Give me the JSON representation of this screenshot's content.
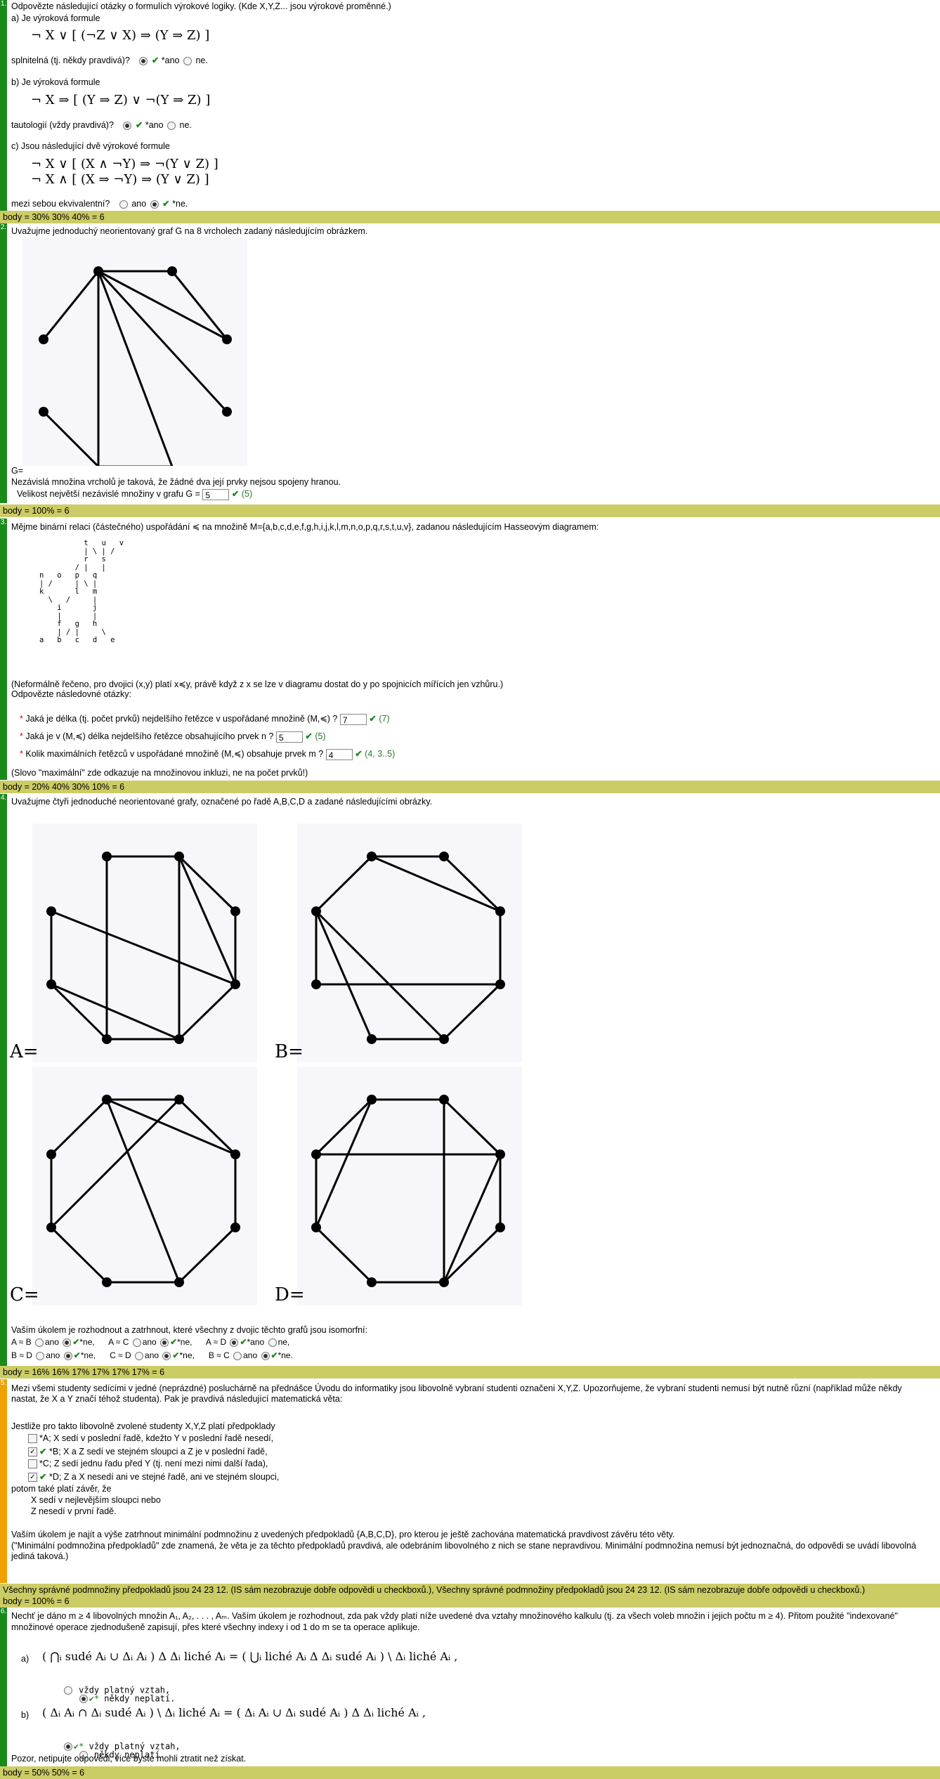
{
  "q1": {
    "num": "1.",
    "intro": "Odpovězte následující otázky o formulích výrokové logiky. (Kde X,Y,Z... jsou výrokové proměnné.)",
    "a_label": "a) Je výroková formule",
    "a_formula": "¬ X ∨ [ (¬Z ∨ X) ⇒ (Y ⇒ Z) ]",
    "a_question": "splnitelná (tj. někdy pravdivá)?",
    "b_label": "b) Je výroková formule",
    "b_formula": "¬ X ⇒ [ (Y ⇒ Z) ∨ ¬(Y ⇒ Z) ]",
    "b_question": "tautologií (vždy pravdivá)?",
    "c_label": "c) Jsou následující dvě výrokové formule",
    "c_formula1": "¬ X ∨ [ (X ∧ ¬Y) ⇒ ¬(Y ∨ Z) ]",
    "c_formula2": "¬ X ∧ [ (X ⇒ ¬Y) ⇒ (Y ∨ Z) ]",
    "c_question": "mezi sebou ekvivalentní?",
    "yes_star": "*ano",
    "no": "ne.",
    "yes": "ano",
    "no_star": "*ne.",
    "check": "✔",
    "points": "body = 30% 30% 40% = 6"
  },
  "q2": {
    "num": "2.",
    "intro": "Uvažujme jednoduchý neorientovaný graf G na 8 vrcholech zadaný následujícím obrázkem.",
    "glabel": "G=",
    "def": "Nezávislá množina vrcholů je taková, že žádné dva její prvky nejsou spojeny hranou.",
    "question": "Velikost největší nezávislé množiny v grafu G =",
    "value": "5",
    "answer": "(5)",
    "points": "body = 100% = 6"
  },
  "q3": {
    "num": "3.",
    "intro": "Mějme binární relaci (částečného) uspořádání ≼ na množině M={a,b,c,d,e,f,g,h,i,j,k,l,m,n,o,p,q,r,s,t,u,v}, zadanou následujícím Hasseovým diagramem:",
    "hasse_lines": [
      "          t   u   v",
      "          | \\ | /",
      "          r   s",
      "        / |   |",
      "n   o   p   q",
      "| /     | \\ |",
      "k       l   m",
      "  \\   /     |",
      "    i       j",
      "    |       |",
      "    f   g   h",
      "    | / |     \\",
      "a   b   c   d   e"
    ],
    "informal": "(Neformálně řečeno, pro dvojici (x,y) platí x≼y, právě když z x se lze v diagramu dostat do y po spojnicích mířících jen vzhůru.)",
    "answer_prompt": "Odpovězte následovné otázky:",
    "items": [
      {
        "text": "Jaká je délka (tj. počet prvků) nejdelšího řetězce v uspořádané množině (M,≼) ?",
        "value": "7",
        "answer": "(7)"
      },
      {
        "text": "Jaká je v (M,≼) délka nejdelšího řetězce obsahujícího prvek n ?",
        "value": "5",
        "answer": "(5)"
      },
      {
        "text": "Kolik maximálních řetězců v uspořádané množině (M,≼) obsahuje prvek m ?",
        "value": "4",
        "answer": "(4, 3..5)"
      }
    ],
    "note": "(Slovo \"maximální\" zde odkazuje na množinovou inkluzi, ne na počet prvků!)",
    "points": "body = 20% 40% 30% 10% = 6"
  },
  "q4": {
    "num": "4.",
    "intro": "Uvažujme čtyři jednoduché neorientované grafy, označené po řadě A,B,C,D a zadané následujícími obrázky.",
    "labels": [
      "A=",
      "B=",
      "C=",
      "D="
    ],
    "task": "Vaším úkolem je rozhodnout a zatrhnout, které všechny z dvojic těchto grafů jsou isomorfní:",
    "pairs": [
      {
        "label": "A ≈ B",
        "yes": "ano",
        "no": "*ne,",
        "sel": "no"
      },
      {
        "label": "A ≈ C",
        "yes": "ano",
        "no": "*ne,",
        "sel": "no"
      },
      {
        "label": "A ≈ D",
        "yes": "*ano",
        "no": "ne,",
        "sel": "yes"
      },
      {
        "label": "B ≈ D",
        "yes": "ano",
        "no": "*ne,",
        "sel": "no"
      },
      {
        "label": "C ≈ D",
        "yes": "ano",
        "no": "*ne,",
        "sel": "no"
      },
      {
        "label": "B ≈ C",
        "yes": "ano",
        "no": "*ne.",
        "sel": "no"
      }
    ],
    "points": "body = 16% 16% 17% 17% 17% 17% = 6"
  },
  "q5": {
    "num": "5.",
    "intro": "Mezi všemi studenty sedícími v jedné (neprázdné) posluchárně na přednášce Úvodu do informatiky jsou libovolně vybraní studenti označeni X,Y,Z. Upozorňujeme, že vybraní studenti nemusí být nutně různí (například může někdy nastat, že X a Y značí téhož studenta). Pak je pravdivá následující matematická věta:",
    "premise": "Jestliže pro takto libovolně zvolené studenty X,Y,Z platí předpoklady",
    "options": [
      {
        "text": "*A;  X sedí v poslední řadě, kdežto Y v poslední řadě nesedí,",
        "checked": false
      },
      {
        "text": "*B;  X a Z sedí ve stejném sloupci a Z je v poslední řadě,",
        "checked": true
      },
      {
        "text": "*C;  Z sedí jednu řadu před Y (tj. není mezi nimi další řada),",
        "checked": false
      },
      {
        "text": "*D;  Z a X nesedí ani ve stejné řadě, ani ve stejném sloupci,",
        "checked": true
      }
    ],
    "conclusion": [
      "potom také platí závěr, že",
      "X sedí v nejlevějším sloupci  nebo",
      "Z nesedí v první řadě."
    ],
    "task1": "Vaším úkolem je najít a výše zatrhnout minimální podmnožinu z uvedených předpokladů {A,B,C,D}, pro kterou je ještě zachována matematická pravdivost závěru této věty.",
    "task2": "(\"Minimální podmnožina předpokladů\" zde znamená, že věta je za těchto předpokladů pravdivá, ale odebráním libovolného z nich se stane nepravdivou. Minimální podmnožina nemusí být jednoznačná, do odpovědi se uvádí libovolná jediná taková.)",
    "summary": "Všechny správné podmnožiny předpokladů jsou 24 23 12. (IS sám nezobrazuje dobře odpovědi u checkboxů.), Všechny správné podmnožiny předpokladů jsou 24 23 12. (IS sám nezobrazuje dobře odpovědi u checkboxů.)",
    "points": "body = 100% = 6"
  },
  "q6": {
    "num": "6.",
    "intro": "Nechť je dáno m ≥ 4 libovolných množin A₁, A₂, . . . , Aₘ. Vaším úkolem je rozhodnout, zda pak vždy platí níže uvedené dva vztahy množinového kalkulu (tj. za všech voleb množin i jejich počtu m ≥ 4). Přitom použité \"indexované\" množinové operace zjednodušeně zapisují, přes které všechny indexy i od 1 do m se ta operace aplikuje.",
    "a_label": "a)",
    "a_formula": "( ⋂ᵢ sudé Aᵢ ∪ Δᵢ Aᵢ ) Δ Δᵢ liché Aᵢ  =  ( ⋃ᵢ liché Aᵢ Δ Δᵢ sudé Aᵢ ) \\ Δᵢ liché Aᵢ ,",
    "b_label": "b)",
    "b_formula": "( Δᵢ Aᵢ ∩ Δᵢ sudé Aᵢ ) \\ Δᵢ liché Aᵢ  =  ( Δᵢ Aᵢ ∪ Δᵢ sudé Aᵢ ) Δ Δᵢ liché Aᵢ ,",
    "always": "vždy platný vztah,",
    "sometimes": "někdy neplatí.",
    "star": "*",
    "warning": "Pozor, netipujte odpovědi, více byste mohli ztratit než získat.",
    "points": "body = 50% 50% = 6"
  },
  "colors": {
    "bar_green": "#1a8a1a",
    "bar_orange": "#f0a000",
    "points_bg": "#cccc66",
    "check": "#1a8a1a"
  }
}
